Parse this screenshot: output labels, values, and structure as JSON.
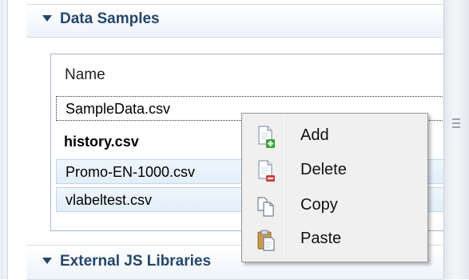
{
  "sections": {
    "data_samples": {
      "title": "Data Samples",
      "expanded": true
    },
    "external_js": {
      "title": "External JS Libraries",
      "expanded": true
    }
  },
  "table": {
    "column_header": "Name",
    "rows": [
      {
        "name": "SampleData.csv",
        "state": "focused"
      },
      {
        "name": "history.csv",
        "state": "bold"
      },
      {
        "name": "Promo-EN-1000.csv",
        "state": "selected"
      },
      {
        "name": "vlabeltest.csv",
        "state": "selected"
      }
    ]
  },
  "context_menu": {
    "items": [
      {
        "label": "Add",
        "icon": "add-document-icon"
      },
      {
        "label": "Delete",
        "icon": "delete-document-icon"
      },
      {
        "label": "Copy",
        "icon": "copy-icon"
      },
      {
        "label": "Paste",
        "icon": "paste-icon"
      }
    ]
  },
  "colors": {
    "section_title": "#24476b",
    "selection_bg": "#e3eef9",
    "menu_bg": "#f0f0f0"
  }
}
